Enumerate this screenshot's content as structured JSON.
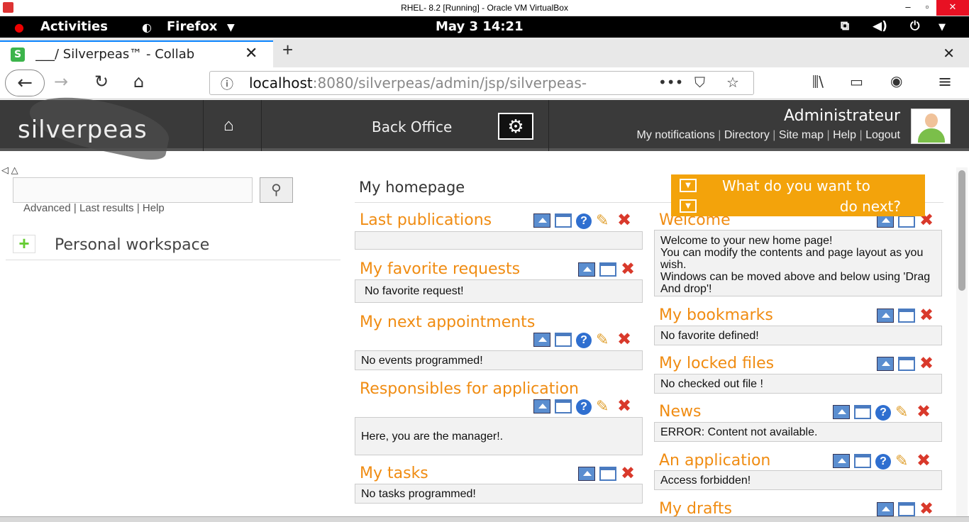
{
  "vbox": {
    "title": "RHEL- 8.2 [Running] - Oracle VM VirtualBox",
    "minimize": "–",
    "restore": "▫",
    "close": "✕"
  },
  "gnome": {
    "activities": "Activities",
    "app": "Firefox",
    "clock": "May 3  14:21"
  },
  "browser": {
    "tab_label": "___/ Silverpeas™ - Collab",
    "tab_close": "✕",
    "new_tab": "+",
    "window_close": "✕",
    "url_host": "localhost",
    "url_rest": ":8080/silverpeas/admin/jsp/silverpeas-",
    "url_more": "•••"
  },
  "header": {
    "logo": "silverpeas",
    "back_office": "Back Office",
    "user": "Administrateur",
    "links": [
      "My notifications",
      "Directory",
      "Site map",
      "Help",
      "Logout"
    ]
  },
  "left": {
    "collapse": "◁ △",
    "search_placeholder": "",
    "search_links": "Advanced | Last results | Help",
    "personal_workspace": "Personal workspace"
  },
  "main": {
    "title": "My homepage",
    "next_line1": "What do you want to",
    "next_line2": "do next?"
  },
  "portlets_left": [
    {
      "title": "Last publications",
      "body": ""
    },
    {
      "title": "My favorite requests",
      "body": "No favorite request!"
    },
    {
      "title": "My next appointments",
      "body": "No events programmed!"
    },
    {
      "title": "Responsibles for application",
      "body": "Here, you are the manager!."
    },
    {
      "title": "My tasks",
      "body": "No tasks programmed!"
    }
  ],
  "portlets_right": [
    {
      "title": "Welcome",
      "body": "Welcome to your new home page!\nYou can modify the contents and page layout as you wish.\nWindows can be moved above and below using 'Drag And drop'!"
    },
    {
      "title": "My bookmarks",
      "body": "No favorite defined!"
    },
    {
      "title": "My locked files",
      "body": "No checked out file !"
    },
    {
      "title": "News",
      "body": "ERROR: Content not available."
    },
    {
      "title": "An application",
      "body": "Access forbidden!"
    },
    {
      "title": "My drafts",
      "body": ""
    }
  ],
  "icon_glyphs": {
    "help": "?",
    "edit": "✎",
    "delete": "✖"
  }
}
